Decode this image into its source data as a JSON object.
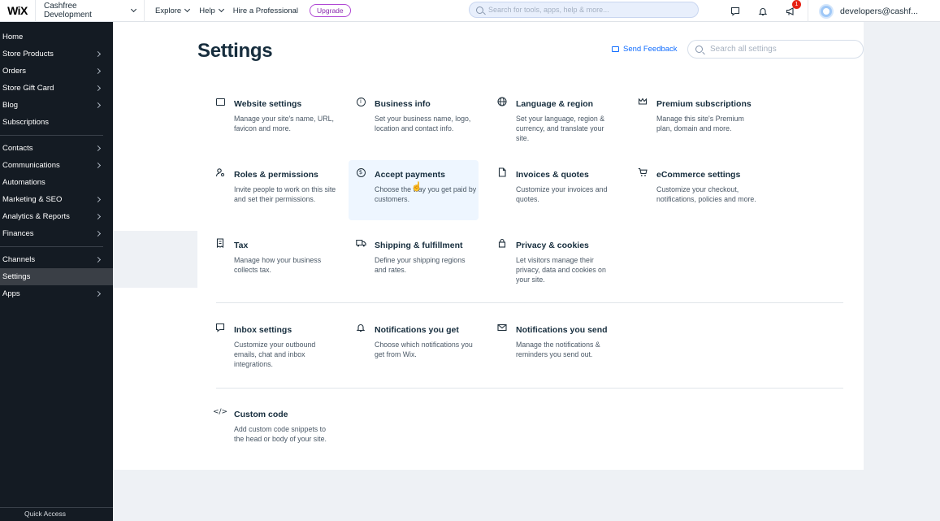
{
  "topbar": {
    "logo": "WiX",
    "site_name": "Cashfree Development",
    "nav": [
      "Explore",
      "Help",
      "Hire a Professional"
    ],
    "upgrade_label": "Upgrade",
    "search_placeholder": "Search for tools, apps, help & more...",
    "notification_badge": "1",
    "account_label": "developers@cashf..."
  },
  "sidebar": {
    "groups": [
      [
        {
          "label": "Home",
          "chevron": false
        },
        {
          "label": "Store Products",
          "chevron": true
        },
        {
          "label": "Orders",
          "chevron": true
        },
        {
          "label": "Store Gift Card",
          "chevron": true
        },
        {
          "label": "Blog",
          "chevron": true
        },
        {
          "label": "Subscriptions",
          "chevron": false
        }
      ],
      [
        {
          "label": "Contacts",
          "chevron": true
        },
        {
          "label": "Communications",
          "chevron": true
        },
        {
          "label": "Automations",
          "chevron": false
        },
        {
          "label": "Marketing & SEO",
          "chevron": true
        },
        {
          "label": "Analytics & Reports",
          "chevron": true
        },
        {
          "label": "Finances",
          "chevron": true
        }
      ],
      [
        {
          "label": "Channels",
          "chevron": true
        },
        {
          "label": "Settings",
          "chevron": false,
          "active": true
        },
        {
          "label": "Apps",
          "chevron": true
        }
      ]
    ],
    "bottom_label": "Quick Access"
  },
  "page": {
    "title": "Settings",
    "feedback_label": "Send Feedback",
    "search_placeholder": "Search all settings"
  },
  "cards": [
    {
      "id": "website",
      "icon": "browser-icon",
      "title": "Website settings",
      "desc": "Manage your site's name, URL, favicon and more."
    },
    {
      "id": "business",
      "icon": "info-icon",
      "title": "Business info",
      "desc": "Set your business name, logo, location and contact info."
    },
    {
      "id": "language",
      "icon": "globe-icon",
      "title": "Language & region",
      "desc": "Set your language, region & currency, and translate your site."
    },
    {
      "id": "premium",
      "icon": "crown-icon",
      "title": "Premium subscriptions",
      "desc": "Manage this site's Premium plan, domain and more."
    },
    {
      "id": "roles",
      "icon": "user-key-icon",
      "title": "Roles & permissions",
      "desc": "Invite people to work on this site and set their permissions."
    },
    {
      "id": "payments",
      "icon": "dollar-icon",
      "title": "Accept payments",
      "desc": "Choose the way you get paid by customers."
    },
    {
      "id": "invoices",
      "icon": "document-icon",
      "title": "Invoices & quotes",
      "desc": "Customize your invoices and quotes."
    },
    {
      "id": "ecommerce",
      "icon": "cart-icon",
      "title": "eCommerce settings",
      "desc": "Customize your checkout, notifications, policies and more."
    },
    {
      "id": "tax",
      "icon": "receipt-icon",
      "title": "Tax",
      "desc": "Manage how your business collects tax."
    },
    {
      "id": "shipping",
      "icon": "truck-icon",
      "title": "Shipping & fulfillment",
      "desc": "Define your shipping regions and rates."
    },
    {
      "id": "privacy",
      "icon": "lock-icon",
      "title": "Privacy & cookies",
      "desc": "Let visitors manage their privacy, data and cookies on your site."
    },
    {
      "id": "inbox",
      "icon": "chat-icon",
      "title": "Inbox settings",
      "desc": "Customize your outbound emails, chat and inbox integrations."
    },
    {
      "id": "notif-get",
      "icon": "bell-icon",
      "title": "Notifications you get",
      "desc": "Choose which notifications you get from Wix."
    },
    {
      "id": "notif-send",
      "icon": "envelope-icon",
      "title": "Notifications you send",
      "desc": "Manage the notifications & reminders you send out."
    },
    {
      "id": "custom-code",
      "icon": "code-icon",
      "title": "Custom code",
      "desc": "Add custom code snippets to the head or body of your site."
    }
  ]
}
